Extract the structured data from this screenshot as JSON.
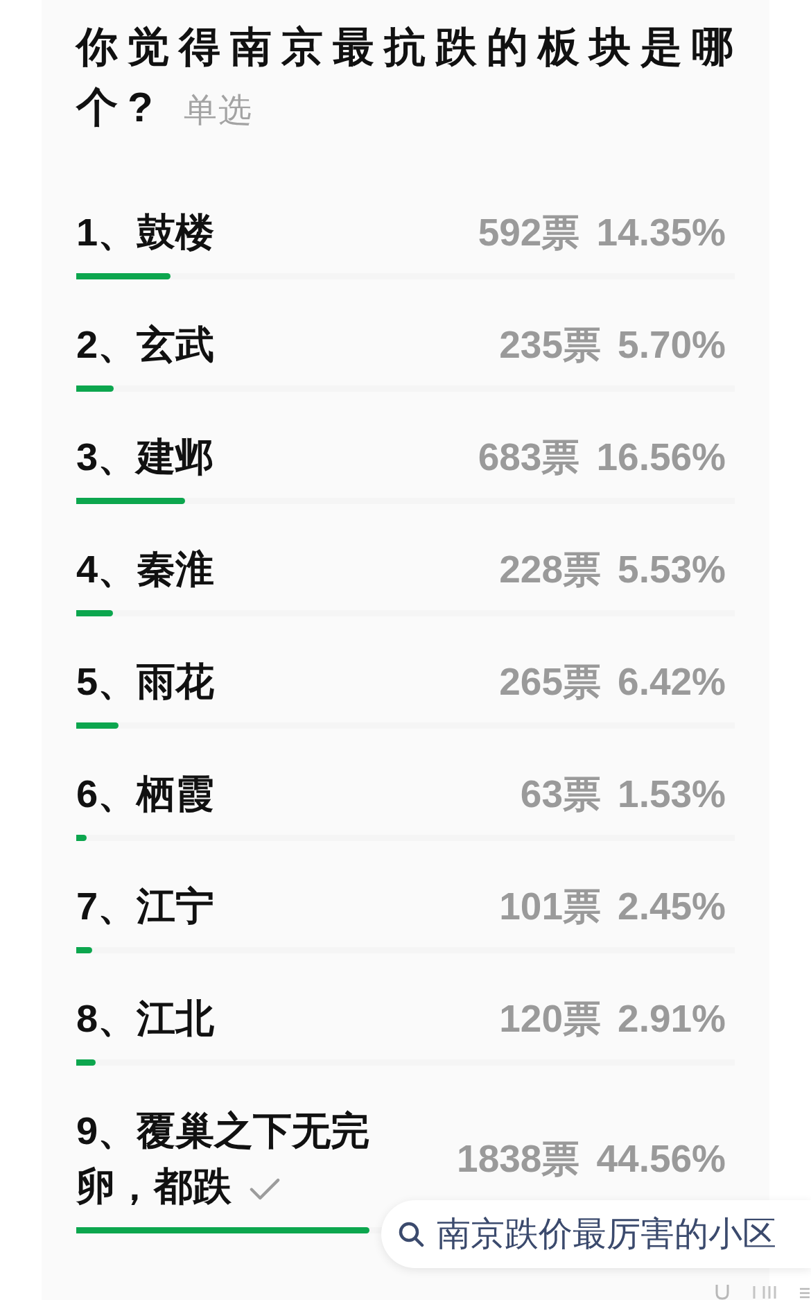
{
  "poll": {
    "question": "你觉得南京最抗跌的板块是哪个?",
    "mode_tag": "单选",
    "options": [
      {
        "label": "1、鼓楼",
        "votes": "592票",
        "percent": "14.35%",
        "level": 0.1435,
        "selected": false
      },
      {
        "label": "2、玄武",
        "votes": "235票",
        "percent": "5.70%",
        "level": 0.057,
        "selected": false
      },
      {
        "label": "3、建邺",
        "votes": "683票",
        "percent": "16.56%",
        "level": 0.1656,
        "selected": false
      },
      {
        "label": "4、秦淮",
        "votes": "228票",
        "percent": "5.53%",
        "level": 0.0553,
        "selected": false
      },
      {
        "label": "5、雨花",
        "votes": "265票",
        "percent": "6.42%",
        "level": 0.0642,
        "selected": false
      },
      {
        "label": "6、栖霞",
        "votes": "63票",
        "percent": "1.53%",
        "level": 0.0153,
        "selected": false
      },
      {
        "label": "7、江宁",
        "votes": "101票",
        "percent": "2.45%",
        "level": 0.0245,
        "selected": false
      },
      {
        "label": "8、江北",
        "votes": "120票",
        "percent": "2.91%",
        "level": 0.0291,
        "selected": false
      },
      {
        "label": "9、覆巢之下无完卵，都跌",
        "votes": "1838票",
        "percent": "44.56%",
        "level": 0.4456,
        "selected": true
      }
    ]
  },
  "search_suggestion": {
    "text": "南京跌价最厉害的小区"
  }
}
